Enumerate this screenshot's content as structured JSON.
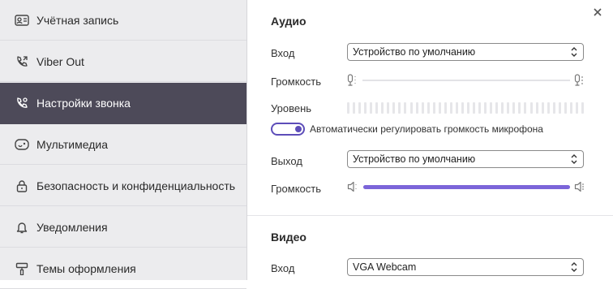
{
  "sidebar": {
    "items": [
      {
        "label": "Учётная запись",
        "icon": "account-card-icon"
      },
      {
        "label": "Viber Out",
        "icon": "phone-outgoing-icon"
      },
      {
        "label": "Настройки звонка",
        "icon": "call-settings-icon",
        "active": true
      },
      {
        "label": "Мультимедиа",
        "icon": "multimedia-icon"
      },
      {
        "label": "Безопасность и конфиденциальность",
        "icon": "lock-icon"
      },
      {
        "label": "Уведомления",
        "icon": "bell-icon"
      },
      {
        "label": "Темы оформления",
        "icon": "paint-roller-icon"
      }
    ]
  },
  "audio": {
    "title": "Аудио",
    "input_label": "Вход",
    "input_value": "Устройство по умолчанию",
    "input_volume_label": "Громкость",
    "level_label": "Уровень",
    "auto_adjust_label": "Автоматически регулировать громкость микрофона",
    "auto_adjust_on": true,
    "output_label": "Выход",
    "output_value": "Устройство по умолчанию",
    "output_volume_label": "Громкость",
    "output_volume_fraction": 1.0
  },
  "video": {
    "title": "Видео",
    "input_label": "Вход",
    "input_value": "VGA Webcam"
  },
  "colors": {
    "accent": "#7b65d9",
    "sidebar_active": "#4d4a59",
    "sidebar_bg": "#ececee"
  }
}
